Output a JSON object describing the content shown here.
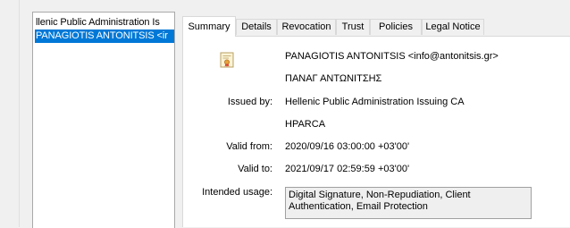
{
  "certificate_list": {
    "items": [
      {
        "label": "llenic Public Administration Is"
      },
      {
        "label": "PANAGIOTIS ANTONITSIS <ir"
      }
    ]
  },
  "tabs": [
    {
      "label": "Summary",
      "active": true
    },
    {
      "label": "Details",
      "active": false
    },
    {
      "label": "Revocation",
      "active": false
    },
    {
      "label": "Trust",
      "active": false
    },
    {
      "label": "Policies",
      "active": false
    },
    {
      "label": "Legal Notice",
      "active": false
    }
  ],
  "summary": {
    "subject_name": "PANAGIOTIS ANTONITSIS <info@antonitsis.gr>",
    "subject_name_greek": "ΠΑΝΑΓ ΑΝΤΩΝΙΤΣΗΣ",
    "issued_by_label": "Issued by:",
    "issued_by_value": "Hellenic Public Administration Issuing CA",
    "issued_by_value2": "HPARCA",
    "valid_from_label": "Valid from:",
    "valid_from_value": "2020/09/16 03:00:00 +03'00'",
    "valid_to_label": "Valid to:",
    "valid_to_value": "2021/09/17 02:59:59 +03'00'",
    "intended_usage_label": "Intended usage:",
    "intended_usage_value": "Digital Signature, Non-Repudiation, Client Authentication, Email Protection"
  },
  "icons": {
    "certificate": "certificate-icon"
  },
  "colors": {
    "selection": "#0078d7",
    "panel_bg": "#ffffff",
    "window_bg": "#f0f0f0"
  }
}
